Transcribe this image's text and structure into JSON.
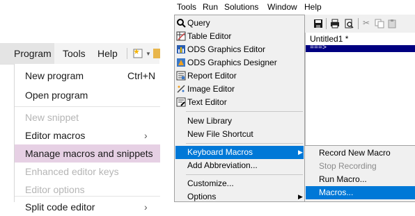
{
  "left": {
    "menubar": {
      "items": [
        "Program",
        "Tools",
        "Help"
      ],
      "icons": [
        "new-item-star-icon",
        "dropdown-caret-icon",
        "folder-icon"
      ]
    },
    "menu": {
      "items": [
        {
          "label": "New program",
          "shortcut": "Ctrl+N"
        },
        {
          "label": "Open program"
        },
        {
          "label": "New snippet"
        },
        {
          "label": "Editor macros"
        },
        {
          "label": "Manage macros and snippets"
        },
        {
          "label": "Enhanced editor keys"
        },
        {
          "label": "Editor options"
        },
        {
          "label": "Split code editor"
        }
      ],
      "highlight_color": "#e6d0e4"
    }
  },
  "right": {
    "menubar": {
      "items": [
        "Tools",
        "Run",
        "Solutions",
        "Window",
        "Help"
      ]
    },
    "document": {
      "title": "Untitled1 *",
      "prompt": "===>"
    },
    "menu": {
      "items": [
        {
          "label": "Query",
          "icon": "query-icon"
        },
        {
          "label": "Table Editor",
          "icon": "table-editor-icon"
        },
        {
          "label": "ODS Graphics Editor",
          "icon": "graphics-editor-icon"
        },
        {
          "label": "ODS Graphics Designer",
          "icon": "graphics-designer-icon"
        },
        {
          "label": "Report Editor",
          "icon": "report-editor-icon"
        },
        {
          "label": "Image Editor",
          "icon": "image-editor-icon"
        },
        {
          "label": "Text Editor",
          "icon": "text-editor-icon"
        },
        {
          "label": "New Library"
        },
        {
          "label": "New File Shortcut"
        },
        {
          "label": "Keyboard Macros"
        },
        {
          "label": "Add Abbreviation..."
        },
        {
          "label": "Customize..."
        },
        {
          "label": "Options"
        }
      ],
      "highlight_color": "#0078d7"
    },
    "submenu": {
      "items": [
        {
          "label": "Record New Macro"
        },
        {
          "label": "Stop Recording"
        },
        {
          "label": "Run Macro..."
        },
        {
          "label": "Macros..."
        }
      ]
    }
  }
}
